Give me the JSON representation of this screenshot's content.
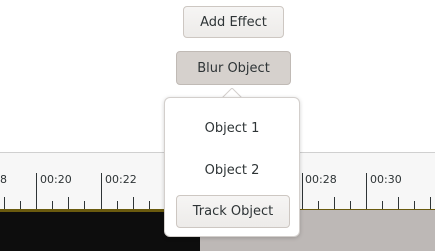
{
  "toolbar": {
    "add_effect_label": "Add Effect",
    "blur_object_label": "Blur Object"
  },
  "popover": {
    "items": [
      {
        "label": "Object 1"
      },
      {
        "label": "Object 2"
      }
    ],
    "track_object_label": "Track Object"
  },
  "timeline": {
    "tick_labels": [
      "8",
      "00:20",
      "00:22",
      "00:28",
      "00:30"
    ],
    "colors": {
      "ruler_bg": "#f7f7f7",
      "clip_dark": "#0d0d0d",
      "clip_gray": "#bdb8b6",
      "clip_accent": "#6a5a0e"
    }
  }
}
